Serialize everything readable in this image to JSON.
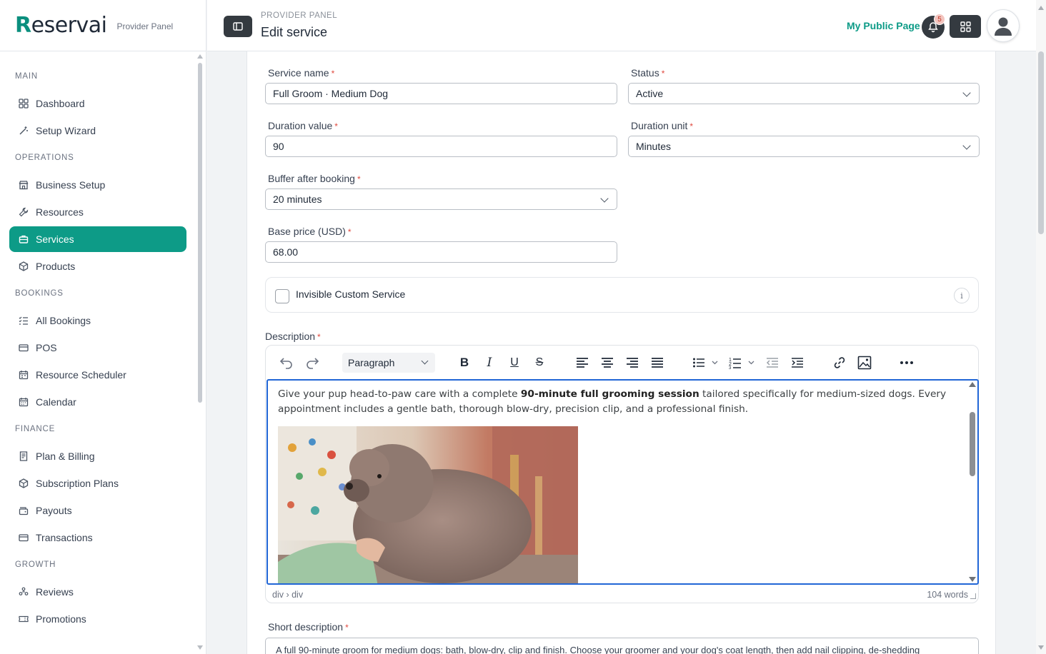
{
  "brand": {
    "name_initial": "R",
    "name_rest": "eservai",
    "subtitle": "Provider Panel"
  },
  "header": {
    "breadcrumb": "PROVIDER PANEL",
    "title": "Edit service",
    "public_link": "My Public Page",
    "notification_count": "5",
    "accent_color": "#0d9b87"
  },
  "sidebar": {
    "sections": [
      {
        "label": "MAIN",
        "items": [
          {
            "label": "Dashboard",
            "icon": "grid-icon"
          },
          {
            "label": "Setup Wizard",
            "icon": "magic-wand-icon"
          }
        ]
      },
      {
        "label": "OPERATIONS",
        "items": [
          {
            "label": "Business Setup",
            "icon": "storefront-icon"
          },
          {
            "label": "Resources",
            "icon": "wrench-icon"
          },
          {
            "label": "Services",
            "icon": "briefcase-icon",
            "active": true
          },
          {
            "label": "Products",
            "icon": "box-icon"
          }
        ]
      },
      {
        "label": "BOOKINGS",
        "items": [
          {
            "label": "All Bookings",
            "icon": "list-check-icon"
          },
          {
            "label": "POS",
            "icon": "card-icon"
          },
          {
            "label": "Resource Scheduler",
            "icon": "calendar-grid-icon"
          },
          {
            "label": "Calendar",
            "icon": "calendar-icon"
          }
        ]
      },
      {
        "label": "FINANCE",
        "items": [
          {
            "label": "Plan & Billing",
            "icon": "receipt-icon"
          },
          {
            "label": "Subscription Plans",
            "icon": "box-icon"
          },
          {
            "label": "Payouts",
            "icon": "wallet-icon"
          },
          {
            "label": "Transactions",
            "icon": "card-icon"
          }
        ]
      },
      {
        "label": "GROWTH",
        "items": [
          {
            "label": "Reviews",
            "icon": "people-icon"
          },
          {
            "label": "Promotions",
            "icon": "ticket-icon"
          }
        ]
      }
    ]
  },
  "form": {
    "service_name": {
      "label": "Service name",
      "value": "Full Groom · Medium Dog"
    },
    "status": {
      "label": "Status",
      "value": "Active"
    },
    "duration_value": {
      "label": "Duration value",
      "value": "90"
    },
    "duration_unit": {
      "label": "Duration unit",
      "value": "Minutes"
    },
    "buffer": {
      "label": "Buffer after booking",
      "value": "20 minutes"
    },
    "base_price": {
      "label": "Base price (USD)",
      "value": "68.00"
    },
    "invisible": {
      "label": "Invisible Custom Service",
      "checked": false
    },
    "description": {
      "label": "Description",
      "block_format": "Paragraph",
      "text_before": "Give your pup head-to-paw care with a complete ",
      "text_bold": "90-minute full grooming session",
      "text_after": " tailored specifically for medium-sized dogs. Every appointment includes a gentle bath, thorough blow-dry, precision clip, and a professional finish.",
      "status_path": "div › div",
      "word_count": "104 words"
    },
    "short_description": {
      "label": "Short description",
      "value": "A full 90-minute groom for medium dogs: bath, blow-dry, clip and finish. Choose your groomer and your dog's coat length, then add nail clipping, de-shedding"
    }
  }
}
